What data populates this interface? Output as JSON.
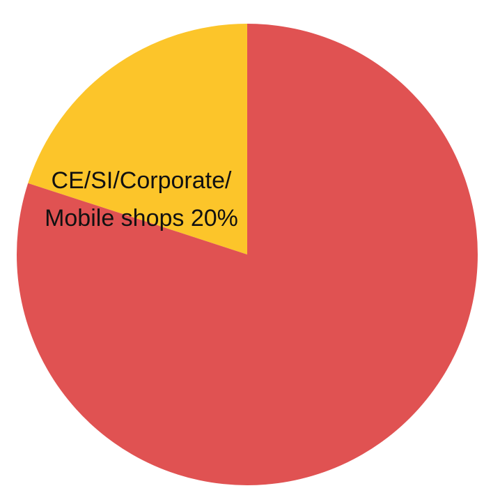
{
  "chart_data": {
    "type": "pie",
    "title": "",
    "slices": [
      {
        "label_lines": [
          "CE/SI/Corporate/",
          "Mobile shops  20%"
        ],
        "value": 20,
        "color": "#fcc52a"
      },
      {
        "label_lines": [],
        "value": 80,
        "color": "#e05252"
      }
    ],
    "legend": "none"
  }
}
